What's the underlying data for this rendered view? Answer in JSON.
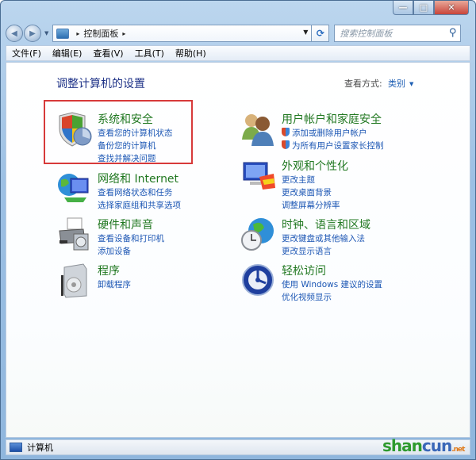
{
  "window": {
    "minimize_label": "—",
    "maximize_label": "□",
    "close_label": "✕"
  },
  "nav": {
    "back_icon": "◀",
    "forward_icon": "▶",
    "history_dropdown": "▼",
    "breadcrumb": [
      "控制面板"
    ],
    "breadcrumb_sep": "▸",
    "address_dropdown": "▼",
    "refresh_icon": "⟳",
    "search_placeholder": "搜索控制面板",
    "search_icon": "⚲"
  },
  "menu": [
    "文件(F)",
    "编辑(E)",
    "查看(V)",
    "工具(T)",
    "帮助(H)"
  ],
  "page": {
    "title": "调整计算机的设置",
    "view_by_label": "查看方式:",
    "view_by_value": "类别",
    "view_by_caret": "▼"
  },
  "categories": [
    {
      "id": "system-security",
      "title": "系统和安全",
      "links": [
        "查看您的计算机状态",
        "备份您的计算机",
        "查找并解决问题"
      ],
      "highlighted": true
    },
    {
      "id": "network-internet",
      "title": "网络和 Internet",
      "links": [
        "查看网络状态和任务",
        "选择家庭组和共享选项"
      ]
    },
    {
      "id": "hardware-sound",
      "title": "硬件和声音",
      "links": [
        "查看设备和打印机",
        "添加设备"
      ]
    },
    {
      "id": "programs",
      "title": "程序",
      "links": [
        "卸载程序"
      ]
    },
    {
      "id": "user-accounts",
      "title": "用户帐户和家庭安全",
      "links": [
        "添加或删除用户帐户",
        "为所有用户设置家长控制"
      ],
      "shield_links": true
    },
    {
      "id": "appearance",
      "title": "外观和个性化",
      "links": [
        "更改主题",
        "更改桌面背景",
        "调整屏幕分辨率"
      ]
    },
    {
      "id": "clock-region",
      "title": "时钟、语言和区域",
      "links": [
        "更改键盘或其他输入法",
        "更改显示语言"
      ]
    },
    {
      "id": "ease-of-access",
      "title": "轻松访问",
      "links": [
        "使用 Windows 建议的设置",
        "优化视频显示"
      ]
    }
  ],
  "status": {
    "text": "计算机"
  },
  "watermark": {
    "part1": "shan",
    "part2": "cun",
    "suffix": ".net"
  },
  "colors": {
    "category_title": "#217821",
    "link": "#1d57b4",
    "page_title": "#1e3287",
    "highlight_border": "#d73a3a"
  }
}
